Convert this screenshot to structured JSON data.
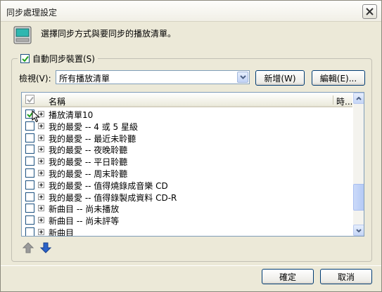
{
  "window": {
    "title": "同步處理設定"
  },
  "header": {
    "instruction": "選擇同步方式與要同步的播放清單。"
  },
  "auto_sync": {
    "label": "自動同步裝置(S)",
    "checked": true
  },
  "view": {
    "label": "檢視(V):",
    "selected": "所有播放清單",
    "new_button": "新增(W)",
    "edit_button": "編輯(E)..."
  },
  "list": {
    "columns": {
      "name": "名稱",
      "time": "時..."
    },
    "items": [
      {
        "label": "播放清單10",
        "checked": true
      },
      {
        "label": "我的最愛 -- 4 或 5 星級",
        "checked": false
      },
      {
        "label": "我的最愛 -- 最近未聆聽",
        "checked": false
      },
      {
        "label": "我的最愛 -- 夜晚聆聽",
        "checked": false
      },
      {
        "label": "我的最愛 -- 平日聆聽",
        "checked": false
      },
      {
        "label": "我的最愛 -- 周末聆聽",
        "checked": false
      },
      {
        "label": "我的最愛 -- 值得燒錄成音樂 CD",
        "checked": false
      },
      {
        "label": "我的最愛 -- 值得錄製成資料 CD-R",
        "checked": false
      },
      {
        "label": "新曲目 -- 尚未播放",
        "checked": false
      },
      {
        "label": "新曲目 -- 尚未評等",
        "checked": false
      },
      {
        "label": "新曲目",
        "checked": false
      }
    ]
  },
  "footer": {
    "ok": "確定",
    "cancel": "取消"
  },
  "colors": {
    "check_green": "#21a121",
    "arrow_blue": "#2a62c9",
    "arrow_gray": "#9a9a9a"
  }
}
